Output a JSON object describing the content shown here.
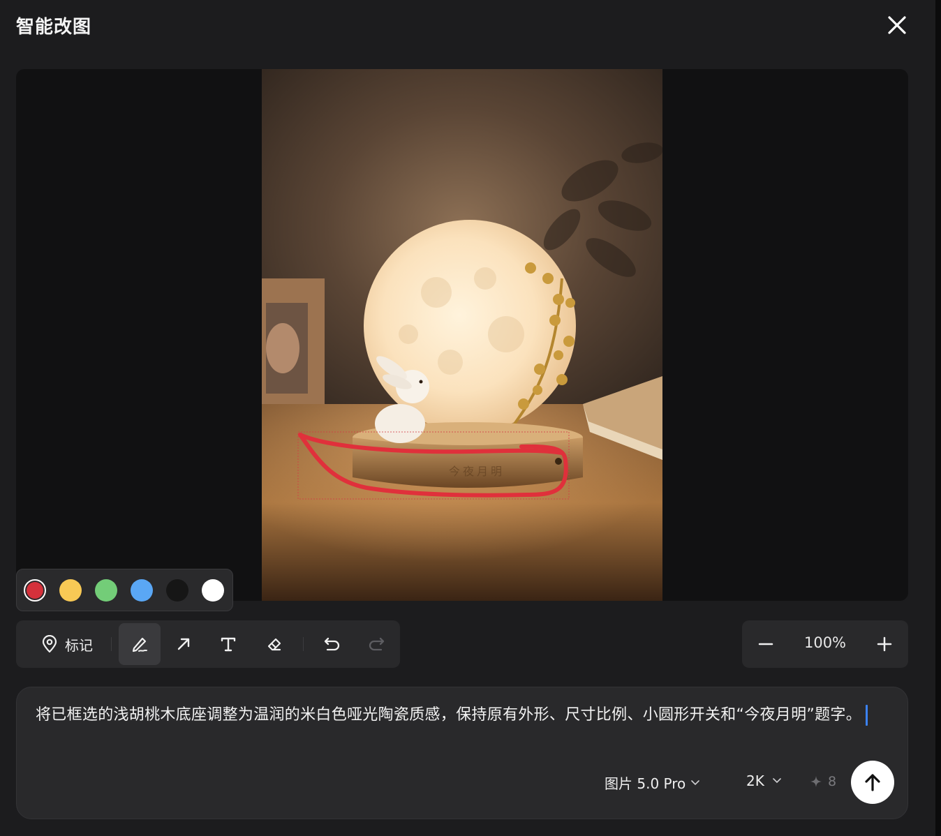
{
  "header": {
    "title": "智能改图"
  },
  "canvas": {
    "engraving": "今夜月明"
  },
  "palette": {
    "colors": [
      {
        "name": "red",
        "hex": "#d5313b",
        "selected": true
      },
      {
        "name": "yellow",
        "hex": "#f8c955",
        "selected": false
      },
      {
        "name": "green",
        "hex": "#73cd78",
        "selected": false
      },
      {
        "name": "blue",
        "hex": "#5aa7f5",
        "selected": false
      },
      {
        "name": "black",
        "hex": "#161616",
        "selected": false
      },
      {
        "name": "white",
        "hex": "#ffffff",
        "selected": false
      }
    ]
  },
  "toolbar": {
    "mark_label": "标记",
    "tools": [
      "pin-icon",
      "brush-icon",
      "arrow-icon",
      "text-icon",
      "eraser-icon",
      "undo-icon",
      "redo-icon"
    ]
  },
  "zoom": {
    "value": "100%"
  },
  "prompt": {
    "text": "将已框选的浅胡桃木底座调整为温润的米白色哑光陶瓷质感，保持原有外形、尺寸比例、小圆形开关和“今夜月明”题字。",
    "model_label": "图片 5.0 Pro",
    "resolution_label": "2K",
    "credits": "8"
  }
}
